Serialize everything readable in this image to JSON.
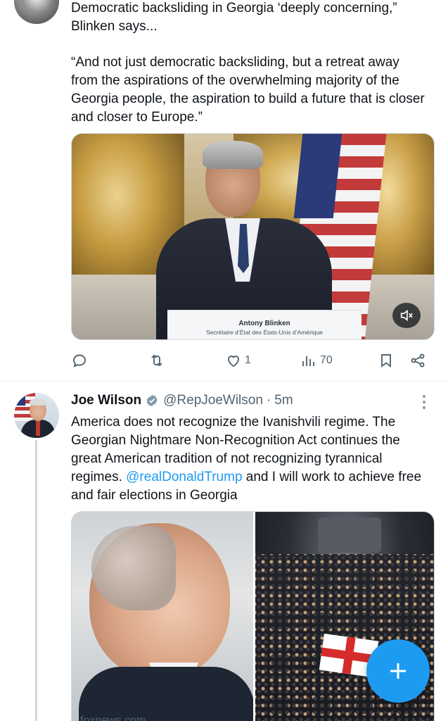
{
  "top_tweet": {
    "text_line1": "Democratic backsliding in Georgia ‘deeply concerning,” Blinken says...",
    "quote": "“And not just democratic backsliding, but a retreat away from the aspirations of the overwhelming majority of the Georgia people, the aspiration to build a future that is closer and closer to Europe.”",
    "video": {
      "lectern_name": "Antony Blinken",
      "lectern_title": "Secrétaire d’État des États-Unis d’Amérique",
      "mute_icon": "muted-speaker-icon"
    },
    "actions": {
      "reply_count": "",
      "repost_count": "",
      "like_count": "1",
      "views_count": "70"
    }
  },
  "main_tweet": {
    "author_name": "Joe Wilson",
    "verified": true,
    "handle": "@RepJoeWilson",
    "separator": "·",
    "time": "5m",
    "body_before_mention": "America does not recognize the Ivanishvili regime. The Georgian Nightmare Non-Recognition Act continues the great American tradition of not recognizing tyrannical regimes. ",
    "mention": "@realDonaldTrump",
    "body_after_mention": " and I will work to achieve free and fair elections in Georgia",
    "link_source": "foxnews.com"
  },
  "fab": {
    "icon": "plus-icon"
  },
  "colors": {
    "accent": "#1d9bf0",
    "text_primary": "#0f1419",
    "text_secondary": "#536471",
    "divider": "#eff3f4"
  }
}
